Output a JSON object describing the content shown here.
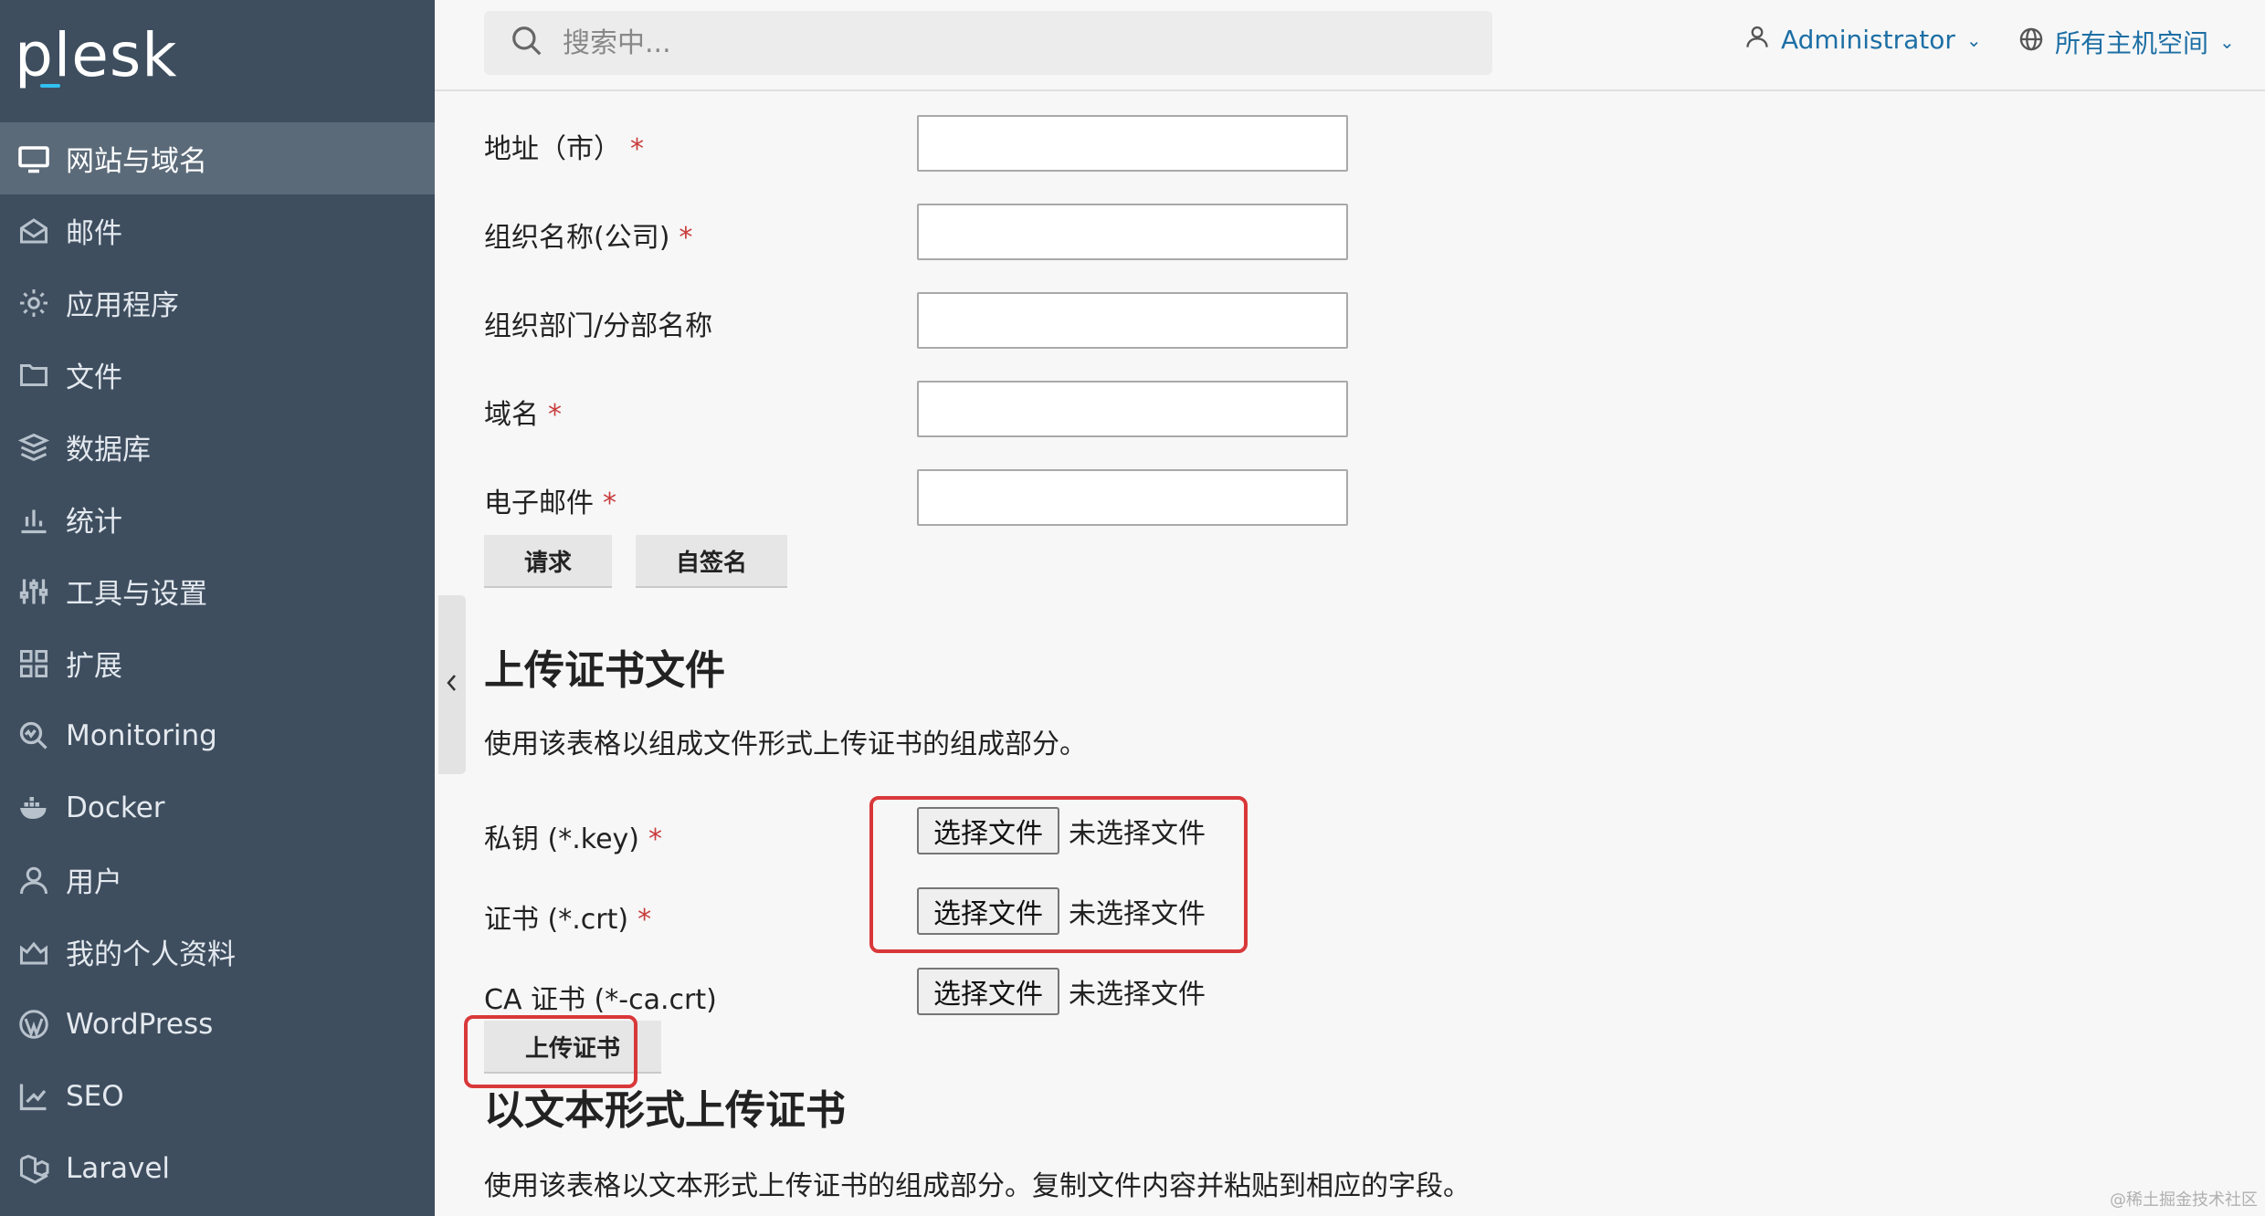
{
  "app": {
    "logo": "plesk"
  },
  "sidebar": {
    "items": [
      {
        "label": "网站与域名",
        "icon": "monitor-icon",
        "active": true
      },
      {
        "label": "邮件",
        "icon": "mail-icon"
      },
      {
        "label": "应用程序",
        "icon": "gear-icon"
      },
      {
        "label": "文件",
        "icon": "folder-icon"
      },
      {
        "label": "数据库",
        "icon": "database-icon"
      },
      {
        "label": "统计",
        "icon": "bar-chart-icon"
      },
      {
        "label": "工具与设置",
        "icon": "sliders-icon"
      },
      {
        "label": "扩展",
        "icon": "grid-icon"
      },
      {
        "label": "Monitoring",
        "icon": "monitoring-icon"
      },
      {
        "label": "Docker",
        "icon": "docker-icon"
      },
      {
        "label": "用户",
        "icon": "user-icon"
      },
      {
        "label": "我的个人资料",
        "icon": "profile-icon"
      },
      {
        "label": "WordPress",
        "icon": "wordpress-icon"
      },
      {
        "label": "SEO",
        "icon": "seo-icon"
      },
      {
        "label": "Laravel",
        "icon": "laravel-icon"
      }
    ]
  },
  "header": {
    "search_placeholder": "搜索中...",
    "user_label": "Administrator",
    "subscriptions_label": "所有主机空间"
  },
  "csr_form": {
    "fields": [
      {
        "label": "地址（市）",
        "required": true,
        "value": ""
      },
      {
        "label": "组织名称(公司)",
        "required": true,
        "value": ""
      },
      {
        "label": "组织部门/分部名称",
        "required": false,
        "value": ""
      },
      {
        "label": "域名",
        "required": true,
        "value": ""
      },
      {
        "label": "电子邮件",
        "required": true,
        "value": ""
      }
    ],
    "request_button": "请求",
    "self_signed_button": "自签名",
    "required_mark": "*"
  },
  "upload_files": {
    "title": "上传证书文件",
    "description": "使用该表格以组成文件形式上传证书的组成部分。",
    "files": [
      {
        "label": "私钥 (*.key)",
        "required": true,
        "button": "选择文件",
        "status": "未选择文件"
      },
      {
        "label": "证书 (*.crt)",
        "required": true,
        "button": "选择文件",
        "status": "未选择文件"
      },
      {
        "label": "CA 证书 (*-ca.crt)",
        "required": false,
        "button": "选择文件",
        "status": "未选择文件"
      }
    ],
    "upload_button": "上传证书"
  },
  "upload_text": {
    "title": "以文本形式上传证书",
    "description": "使用该表格以文本形式上传证书的组成部分。复制文件内容并粘贴到相应的字段。"
  },
  "watermark": "@稀土掘金技术社区",
  "colors": {
    "sidebar_bg": "#3e4e5f",
    "accent": "#1d6fa5",
    "highlight": "#d9383a"
  }
}
